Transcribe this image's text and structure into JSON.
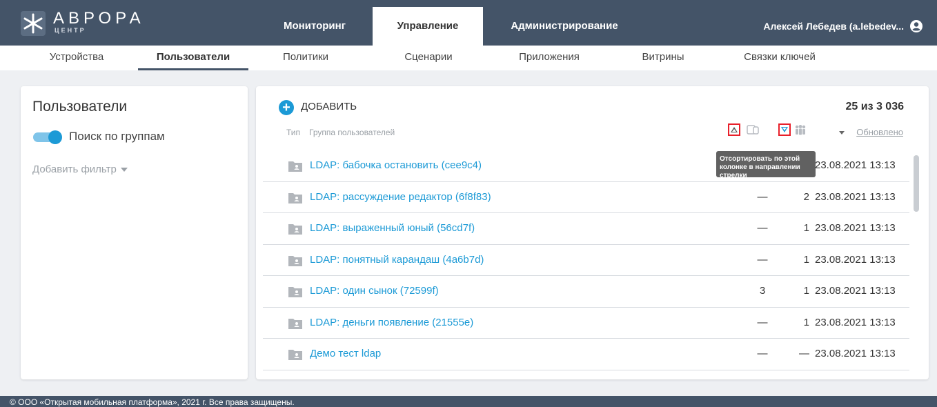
{
  "brand": {
    "name": "АВРОРА",
    "sub": "ЦЕНТР"
  },
  "colors": {
    "header": "#445468",
    "accent": "#1c9ad6",
    "highlight": "#e8202a"
  },
  "main_nav": [
    {
      "label": "Мониторинг",
      "active": false
    },
    {
      "label": "Управление",
      "active": true
    },
    {
      "label": "Администрирование",
      "active": false
    }
  ],
  "user": {
    "name": "Алексей Лебедев (a.lebedev...",
    "icon": "account-circle-icon"
  },
  "sub_nav": [
    {
      "label": "Устройства",
      "active": false
    },
    {
      "label": "Пользователи",
      "active": true
    },
    {
      "label": "Политики",
      "active": false
    },
    {
      "label": "Сценарии",
      "active": false
    },
    {
      "label": "Приложения",
      "active": false
    },
    {
      "label": "Витрины",
      "active": false
    },
    {
      "label": "Связки ключей",
      "active": false
    }
  ],
  "left_panel": {
    "title": "Пользователи",
    "toggle_label": "Поиск по группам",
    "toggle_on": true,
    "add_filter": "Добавить фильтр"
  },
  "list": {
    "add_label": "ДОБАВИТЬ",
    "count": "25 из 3 036",
    "col_type": "Тип",
    "col_group": "Группа пользователей",
    "col_updated": "Обновлено",
    "tooltip": "Отсортировать по этой колонке в направлении стрелки",
    "rows": [
      {
        "name": "LDAP: бабочка остановить (cee9c4)",
        "c1": "",
        "c2": "",
        "date": "23.08.2021 13:13"
      },
      {
        "name": "LDAP: рассуждение редактор (6f8f83)",
        "c1": "—",
        "c2": "2",
        "date": "23.08.2021 13:13"
      },
      {
        "name": "LDAP: выраженный юный (56cd7f)",
        "c1": "—",
        "c2": "1",
        "date": "23.08.2021 13:13"
      },
      {
        "name": "LDAP: понятный карандаш (4a6b7d)",
        "c1": "—",
        "c2": "1",
        "date": "23.08.2021 13:13"
      },
      {
        "name": "LDAP: один сынок (72599f)",
        "c1": "3",
        "c2": "1",
        "date": "23.08.2021 13:13"
      },
      {
        "name": "LDAP: деньги появление (21555e)",
        "c1": "—",
        "c2": "1",
        "date": "23.08.2021 13:13"
      },
      {
        "name": "Демо тест ldap",
        "c1": "—",
        "c2": "—",
        "date": "23.08.2021 13:13"
      }
    ]
  },
  "footer": "© ООО «Открытая мобильная платформа», 2021 г. Все права защищены."
}
